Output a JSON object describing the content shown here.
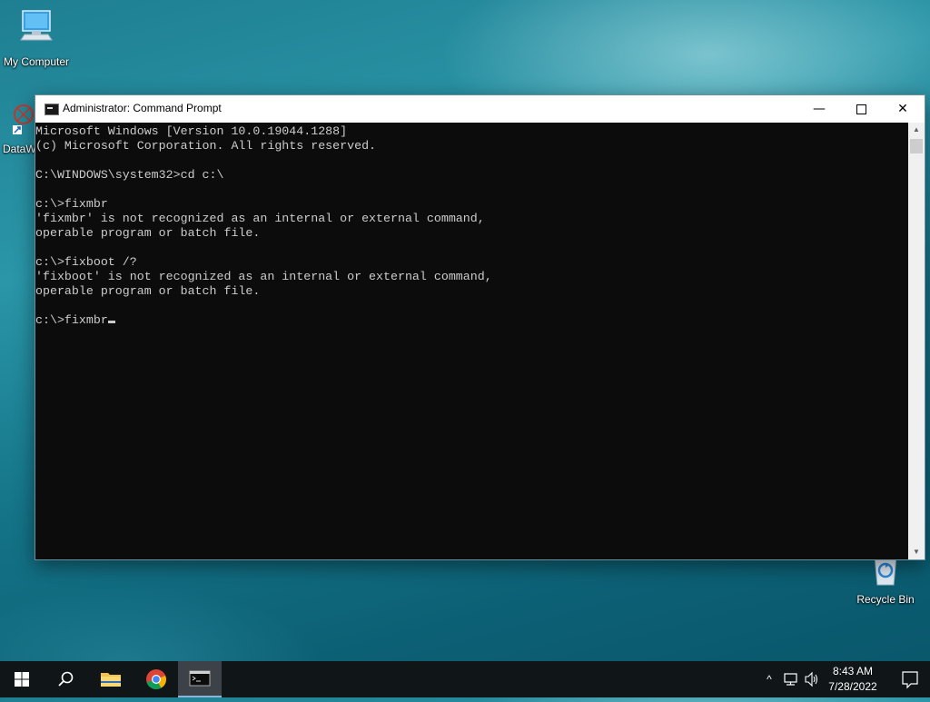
{
  "desktop": {
    "icons": [
      {
        "label": "My Computer"
      },
      {
        "label": "DataW"
      },
      {
        "label": "Recycle Bin"
      }
    ]
  },
  "window": {
    "title": "Administrator: Command Prompt",
    "controls": {
      "minimize": "—",
      "close": "✕"
    },
    "console_text": "Microsoft Windows [Version 10.0.19044.1288]\n(c) Microsoft Corporation. All rights reserved.\n\nC:\\WINDOWS\\system32>cd c:\\\n\nc:\\>fixmbr\n'fixmbr' is not recognized as an internal or external command,\noperable program or batch file.\n\nc:\\>fixboot /?\n'fixboot' is not recognized as an internal or external command,\noperable program or batch file.\n\nc:\\>fixmbr"
  },
  "taskbar": {
    "items": [
      "start-icon",
      "search-icon",
      "file-explorer-icon",
      "chrome-icon",
      "command-prompt-icon"
    ],
    "tray": {
      "chevron": "^"
    },
    "clock": {
      "time": "8:43 AM",
      "date": "7/28/2022"
    }
  },
  "colors": {
    "console_bg": "#0c0c0c",
    "console_text": "#cccccc",
    "taskbar_bg": "#101518",
    "accent": "#8ab4d8"
  }
}
